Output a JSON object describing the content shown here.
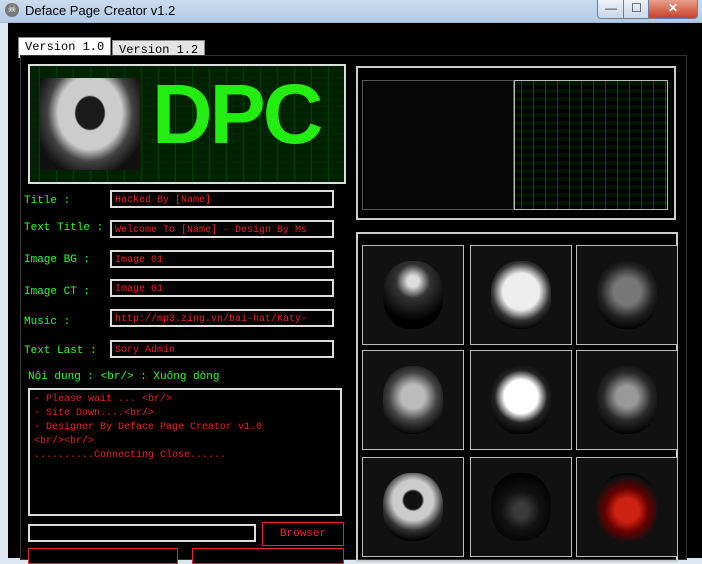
{
  "window": {
    "title": "Deface Page Creator v1.2",
    "min_glyph": "—",
    "max_glyph": "☐",
    "close_glyph": "✕",
    "icon": "skull-icon"
  },
  "tabs": [
    {
      "label": "Version 1.0",
      "active": true
    },
    {
      "label": "Version 1.2",
      "active": false
    }
  ],
  "logo": {
    "text": "DPC"
  },
  "form": {
    "fields": [
      {
        "label": "Title :",
        "value": "Hacked By [Name]"
      },
      {
        "label": "Text Title :",
        "value": "Welcome To [Name] - Design By Ms"
      },
      {
        "label": "Image BG :",
        "value": "Image 01"
      },
      {
        "label": "Image CT :",
        "value": "Image 01"
      },
      {
        "label": "Music :",
        "value": "http://mp3.zing.vn/bai-hat/Katy-"
      },
      {
        "label": "Text Last :",
        "value": "Sory Admin"
      }
    ],
    "content_note": "Nội dung :  <br/> : Xuống dòng",
    "content_lines": [
      "- Please wait ... <br/>",
      "- Site Down....<br/>",
      "- Designer By Deface Page Creator v1.0",
      "<br/><br/>",
      "..........Connecting Close......"
    ],
    "browse_label": "Browser"
  },
  "colors": {
    "accent_green": "#2bff2b",
    "field_text_red": "#f02020",
    "logo_green": "#22ee11"
  },
  "gallery": {
    "thumbnails": [
      "reaper-image",
      "doll-face-image",
      "masked-figure-image",
      "vampire-face-image",
      "clown-mask-image",
      "dark-woman-image",
      "hooded-hacker-image",
      "dark-creature-image",
      "red-skull-image"
    ]
  }
}
